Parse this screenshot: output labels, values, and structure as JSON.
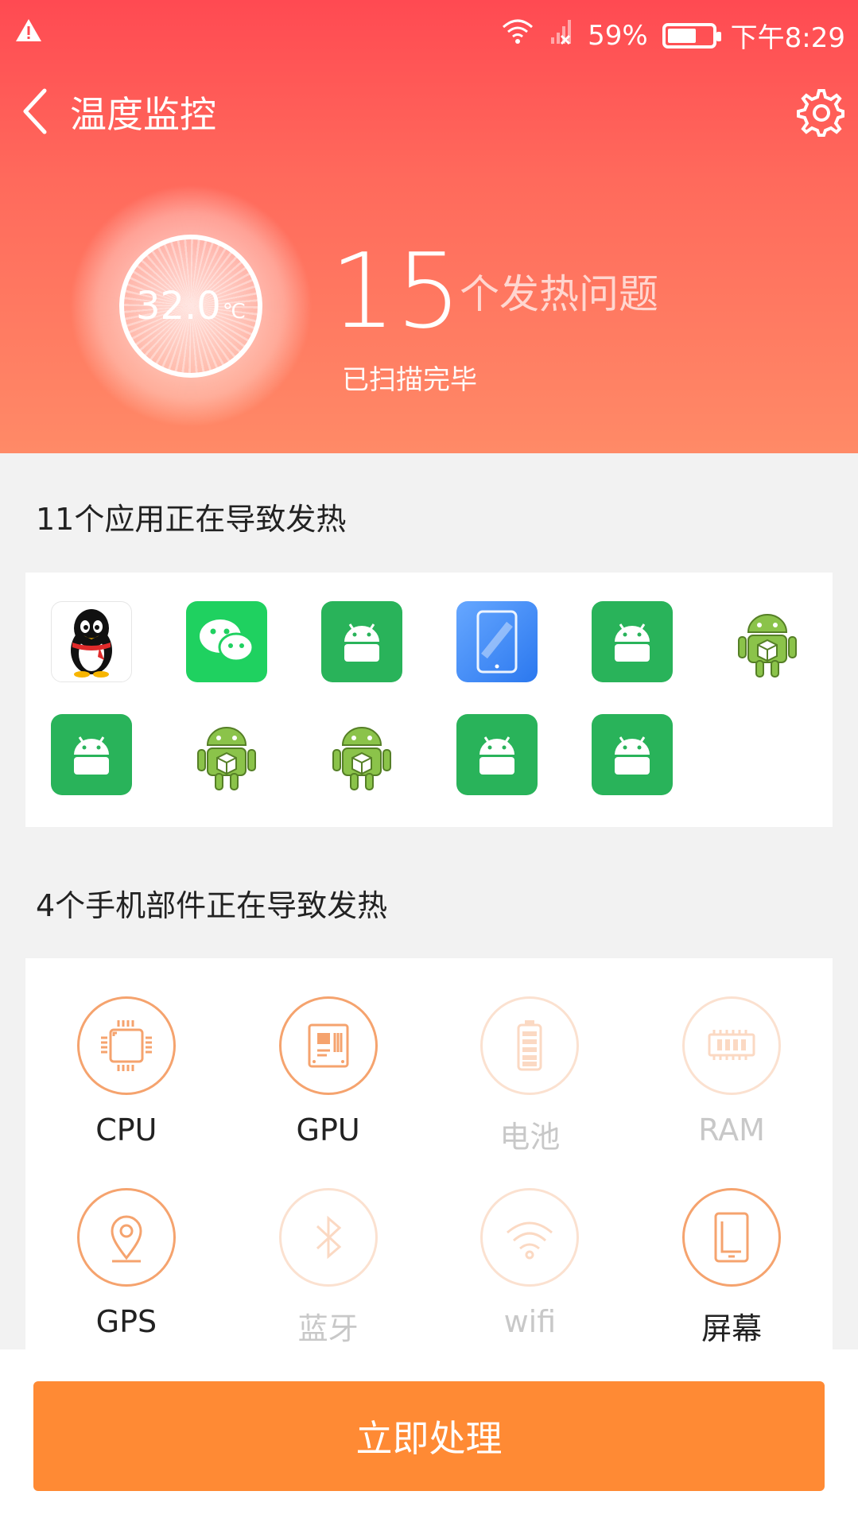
{
  "status_bar": {
    "signal": "59%",
    "time": "下午8:29",
    "battery_level": 0.59
  },
  "header": {
    "title": "温度监控"
  },
  "gauge": {
    "value": "32.0",
    "unit": "℃"
  },
  "summary": {
    "count": "15",
    "count_label": "个发热问题",
    "status": "已扫描完毕"
  },
  "apps_section": {
    "title": "11个应用正在导致发热",
    "apps": [
      {
        "icon": "qq-penguin-icon",
        "style": "white"
      },
      {
        "icon": "wechat-icon",
        "style": "wechat"
      },
      {
        "icon": "android-icon",
        "style": "green"
      },
      {
        "icon": "tablet-icon",
        "style": "blue"
      },
      {
        "icon": "android-icon",
        "style": "green"
      },
      {
        "icon": "android-box-icon",
        "style": "plain"
      },
      {
        "icon": "android-icon",
        "style": "green"
      },
      {
        "icon": "android-box-icon",
        "style": "plain"
      },
      {
        "icon": "android-box-icon",
        "style": "plain"
      },
      {
        "icon": "android-icon",
        "style": "green"
      },
      {
        "icon": "android-icon",
        "style": "green"
      }
    ]
  },
  "parts_section": {
    "title": "4个手机部件正在导致发热",
    "parts": [
      {
        "label": "CPU",
        "icon": "cpu-icon",
        "active": true
      },
      {
        "label": "GPU",
        "icon": "gpu-icon",
        "active": true
      },
      {
        "label": "电池",
        "icon": "battery-icon",
        "active": false
      },
      {
        "label": "RAM",
        "icon": "ram-icon",
        "active": false
      },
      {
        "label": "GPS",
        "icon": "location-pin-icon",
        "active": true
      },
      {
        "label": "蓝牙",
        "icon": "bluetooth-icon",
        "active": false
      },
      {
        "label": "wifi",
        "icon": "wifi-icon",
        "active": false
      },
      {
        "label": "屏幕",
        "icon": "screen-icon",
        "active": true
      }
    ]
  },
  "action": {
    "label": "立即处理"
  },
  "colors": {
    "header_top": "#ff4a52",
    "header_bottom": "#ff8a67",
    "accent": "#ff8a34",
    "part_active": "#f5a36e"
  }
}
